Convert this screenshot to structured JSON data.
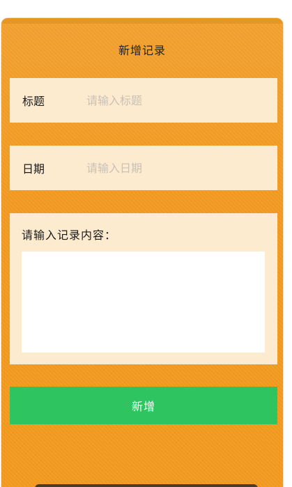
{
  "header": {
    "title": "新增记录"
  },
  "form": {
    "title_field": {
      "label": "标题",
      "placeholder": "请输入标题",
      "value": ""
    },
    "date_field": {
      "label": "日期",
      "placeholder": "请输入日期",
      "value": ""
    },
    "content_field": {
      "label": "请输入记录内容：",
      "value": ""
    },
    "submit_label": "新增"
  },
  "colors": {
    "card_background": "#f39b22",
    "field_background": "#fdebd0",
    "submit_button": "#2ec45f",
    "placeholder_text": "#c9c1b6"
  }
}
